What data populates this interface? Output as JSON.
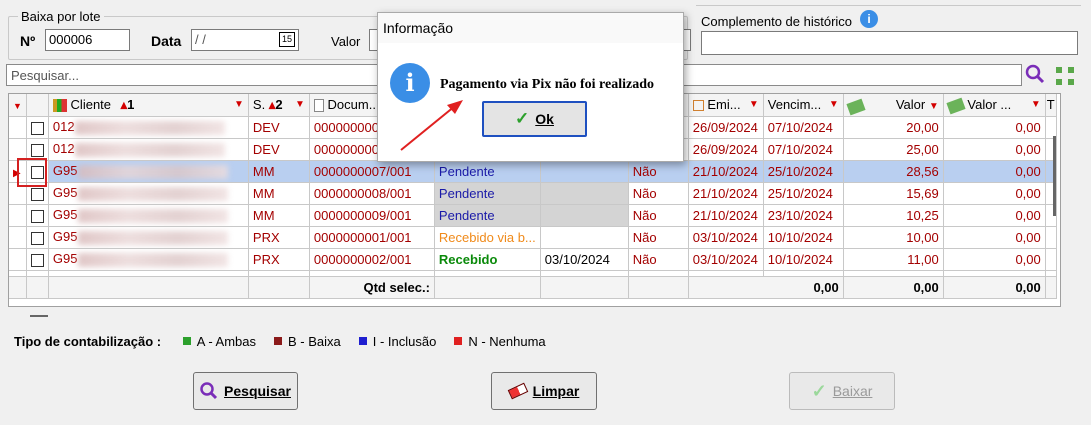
{
  "batch": {
    "legend": "Baixa por lote",
    "number_label": "Nº",
    "number_value": "000006",
    "date_label": "Data",
    "date_value": " /  /",
    "value_label": "Valor"
  },
  "history": {
    "label": "Complemento de histórico"
  },
  "search": {
    "placeholder": "Pesquisar..."
  },
  "grid": {
    "headers": {
      "cliente": "Cliente",
      "sort1": "1",
      "s": "S.",
      "sort2": "2",
      "documento": "Docum...",
      "emissao": "Emi...",
      "vencimento": "Vencim...",
      "valor": "Valor",
      "valor2": "Valor ...",
      "t": "T"
    },
    "rows": [
      {
        "cliente": "012",
        "s": "DEV",
        "doc": "000000000",
        "status": "",
        "pix": "",
        "nao": "",
        "emi": "26/09/2024",
        "venc": "07/10/2024",
        "valor": "20,00",
        "valor2": "0,00"
      },
      {
        "cliente": "012",
        "s": "DEV",
        "doc": "000000000",
        "status": "",
        "pix": "",
        "nao": "",
        "emi": "26/09/2024",
        "venc": "07/10/2024",
        "valor": "25,00",
        "valor2": "0,00"
      },
      {
        "cliente": "G95",
        "s": "MM",
        "doc": "0000000007/001",
        "status": "Pendente",
        "pix": "",
        "nao": "Não",
        "emi": "21/10/2024",
        "venc": "25/10/2024",
        "valor": "28,56",
        "valor2": "0,00"
      },
      {
        "cliente": "G95",
        "s": "MM",
        "doc": "0000000008/001",
        "status": "Pendente",
        "pix": "",
        "nao": "Não",
        "emi": "21/10/2024",
        "venc": "25/10/2024",
        "valor": "15,69",
        "valor2": "0,00"
      },
      {
        "cliente": "G95",
        "s": "MM",
        "doc": "0000000009/001",
        "status": "Pendente",
        "pix": "",
        "nao": "Não",
        "emi": "21/10/2024",
        "venc": "23/10/2024",
        "valor": "10,25",
        "valor2": "0,00"
      },
      {
        "cliente": "G95",
        "s": "PRX",
        "doc": "0000000001/001",
        "status": "Recebido via b...",
        "pix": "",
        "nao": "Não",
        "emi": "03/10/2024",
        "venc": "10/10/2024",
        "valor": "10,00",
        "valor2": "0,00"
      },
      {
        "cliente": "G95",
        "s": "PRX",
        "doc": "0000000002/001",
        "status": "Recebido",
        "pix": "03/10/2024",
        "nao": "Não",
        "emi": "03/10/2024",
        "venc": "10/10/2024",
        "valor": "11,00",
        "valor2": "0,00"
      }
    ],
    "footer": {
      "label": "Qtd selec.:",
      "total1": "0,00",
      "total2": "0,00",
      "total3": "0,00"
    }
  },
  "legend": {
    "title": "Tipo de contabilização :",
    "items": [
      {
        "label": "A - Ambas",
        "color": "#2ca02c"
      },
      {
        "label": "B - Baixa",
        "color": "#8b1a1a"
      },
      {
        "label": "I - Inclusão",
        "color": "#1f1fd0"
      },
      {
        "label": "N - Nenhuma",
        "color": "#e02020"
      }
    ]
  },
  "buttons": {
    "pesquisar": "Pesquisar",
    "limpar": "Limpar",
    "baixar": "Baixar"
  },
  "dialog": {
    "title": "Informação",
    "message": "Pagamento via Pix não foi realizado",
    "ok": "Ok"
  }
}
